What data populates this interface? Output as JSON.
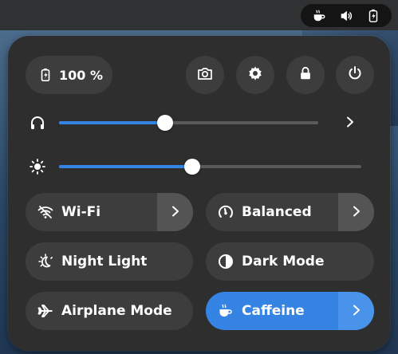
{
  "topbar": {
    "icons": [
      "coffee-cup-icon",
      "volume-icon",
      "battery-charging-icon"
    ]
  },
  "quick_settings": {
    "battery": {
      "label": "100 %",
      "icon": "battery-charging-icon"
    },
    "system_buttons": [
      {
        "name": "screenshot",
        "icon": "camera-icon"
      },
      {
        "name": "settings",
        "icon": "gear-icon"
      },
      {
        "name": "lock",
        "icon": "lock-icon"
      },
      {
        "name": "power",
        "icon": "power-icon"
      }
    ],
    "sliders": {
      "volume": {
        "icon": "headphones-icon",
        "value_percent": 41,
        "has_menu": true
      },
      "brightness": {
        "icon": "brightness-icon",
        "value_percent": 44
      }
    },
    "toggles": {
      "wifi": {
        "label": "Wi-Fi",
        "icon": "wifi-disabled-icon",
        "active": false,
        "has_menu": true
      },
      "power_mode": {
        "label": "Balanced",
        "icon": "gauge-icon",
        "active": false,
        "has_menu": true
      },
      "night_light": {
        "label": "Night Light",
        "icon": "night-light-icon",
        "active": false
      },
      "dark_mode": {
        "label": "Dark Mode",
        "icon": "dark-mode-icon",
        "active": false
      },
      "airplane": {
        "label": "Airplane Mode",
        "icon": "airplane-icon",
        "active": false
      },
      "caffeine": {
        "label": "Caffeine",
        "icon": "coffee-cup-icon",
        "active": true,
        "has_menu": true
      }
    }
  },
  "colors": {
    "accent": "#3584e4",
    "panel_bg": "#2e2e2e",
    "button_bg": "#3d3d3d",
    "text": "#ffffff"
  }
}
